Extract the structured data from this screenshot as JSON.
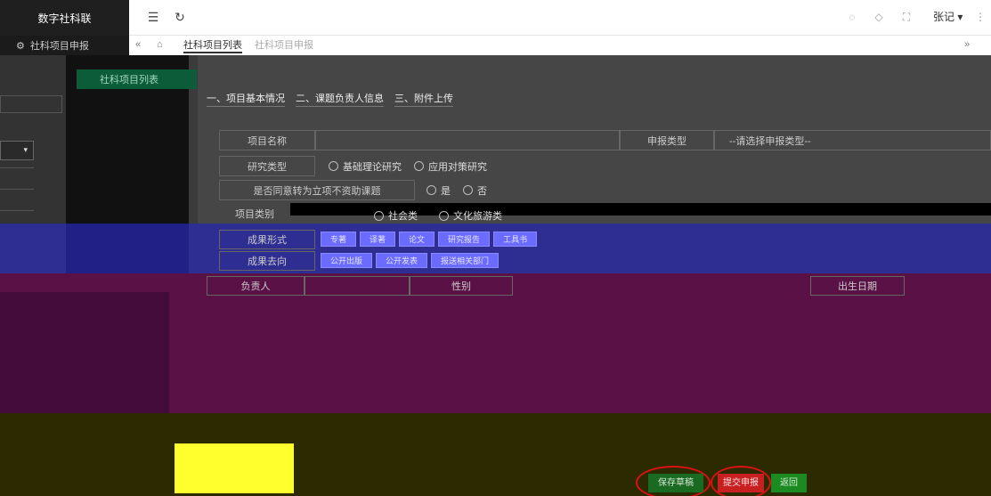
{
  "app": {
    "brand": "数字社科联"
  },
  "header": {
    "user": "张记 ▾"
  },
  "sidebar": {
    "menu_title": "社科项目申报",
    "sub_item": "社科项目列表"
  },
  "tabs": [
    {
      "label": "社科项目列表"
    },
    {
      "label": "社科项目申报"
    }
  ],
  "sections": [
    {
      "label": "一、项目基本情况"
    },
    {
      "label": "二、课题负责人信息"
    },
    {
      "label": "三、附件上传"
    }
  ],
  "form": {
    "project_name_label": "项目名称",
    "apply_type_label": "申报类型",
    "apply_type_placeholder": "--请选择申报类型--",
    "research_type_label": "研究类型",
    "research_options": [
      "基础理论研究",
      "应用对策研究"
    ],
    "transfer_label": "是否同意转为立项不资助课题",
    "transfer_options": [
      "是",
      "否"
    ],
    "category_label": "项目类别",
    "category_options": [
      "社会类",
      "文化旅游类"
    ],
    "result_form_label": "成果形式",
    "result_forms": [
      "专著",
      "译著",
      "论文",
      "研究报告",
      "工具书"
    ],
    "result_direction_label": "成果去向",
    "result_directions": [
      "公开出版",
      "公开发表",
      "报送相关部门"
    ],
    "leader_label": "负责人",
    "gender_label": "性别",
    "birth_label": "出生日期"
  },
  "actions": {
    "save": "保存草稿",
    "submit": "提交申报",
    "back": "返回"
  },
  "colors": {
    "save_green": "#1a6a21",
    "submit_red": "#c82020",
    "highlight_ring": "#d11111"
  }
}
